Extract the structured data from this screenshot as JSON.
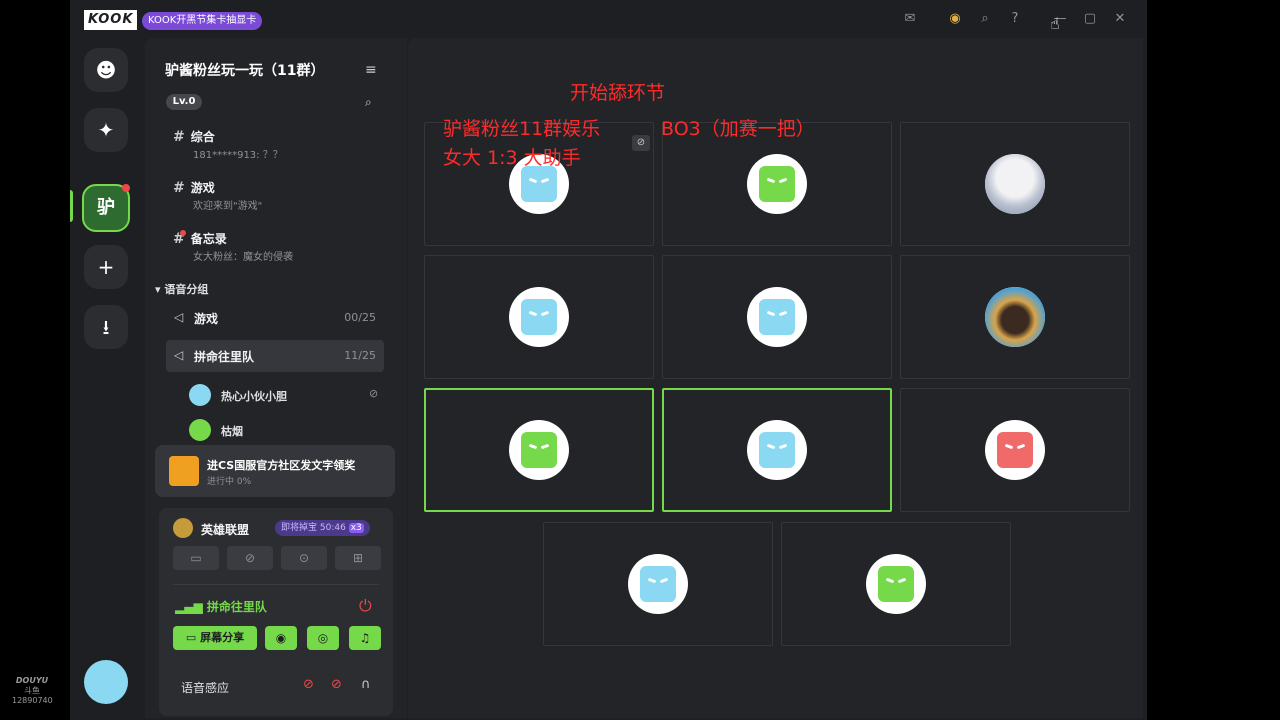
{
  "titlebar": {
    "logo": "KOOK",
    "promo": "KOOK开黑节集卡抽显卡",
    "icons": [
      "inbox-icon",
      "gift-icon",
      "search-icon",
      "help-icon",
      "minimize-icon",
      "maximize-icon",
      "close-icon"
    ]
  },
  "rail": {
    "server_initial": "驴"
  },
  "server": {
    "name": "驴酱粉丝玩一玩（11群）",
    "level": "Lv.0"
  },
  "channels": [
    {
      "name": "综合",
      "preview": "181*****913: ？？"
    },
    {
      "name": "游戏",
      "preview": "欢迎来到\"游戏\""
    },
    {
      "name": "备忘录",
      "preview": "女大粉丝：魔女的侵袭"
    }
  ],
  "voice_group": {
    "title": "语音分组",
    "channels": [
      {
        "name": "游戏",
        "count": "00/25"
      },
      {
        "name": "拼命往里队",
        "count": "11/25"
      }
    ],
    "members": [
      {
        "name": "热心小伙小胆",
        "color": "#8ad8f2"
      },
      {
        "name": "枯烟",
        "color": "#76d94a"
      }
    ]
  },
  "banner": {
    "title": "进CS国服官方社区发文字领奖",
    "subtitle": "进行中 0%"
  },
  "game_panel": {
    "game_name": "英雄联盟",
    "badge": "即将掉宝 50:46",
    "badge_mult": "x3",
    "voice_channel": "拼命往里队",
    "share_label": "屏幕分享",
    "voice_sense": "语音感应"
  },
  "overlay_text": {
    "line1": "开始舔环节",
    "line2a": "驴酱粉丝11群娱乐",
    "line2b": "BO3（加赛一把）",
    "line3": "女大 1:3 大助手"
  },
  "tiles": [
    {
      "face": "#8ad8f2",
      "muted": true,
      "speaking": false
    },
    {
      "face": "#76d94a",
      "muted": false,
      "speaking": false
    },
    {
      "photo": "photo1",
      "muted": false,
      "speaking": false
    },
    {
      "face": "#8ad8f2",
      "muted": false,
      "speaking": false
    },
    {
      "face": "#8ad8f2",
      "muted": false,
      "speaking": false
    },
    {
      "photo": "photo2",
      "muted": false,
      "speaking": false
    },
    {
      "face": "#76d94a",
      "muted": false,
      "speaking": true
    },
    {
      "face": "#8ad8f2",
      "muted": false,
      "speaking": true
    },
    {
      "face": "#f06a6a",
      "muted": false,
      "speaking": false
    },
    {
      "face": "#8ad8f2",
      "muted": false,
      "speaking": false
    },
    {
      "face": "#76d94a",
      "muted": false,
      "speaking": false
    }
  ],
  "watermark": {
    "brand": "DOUYU",
    "sub": "斗鱼",
    "room": "12890740"
  },
  "colors": {
    "accent": "#76d94a",
    "danger": "#f04747",
    "background": "#1e1f22",
    "panel": "#232428"
  }
}
